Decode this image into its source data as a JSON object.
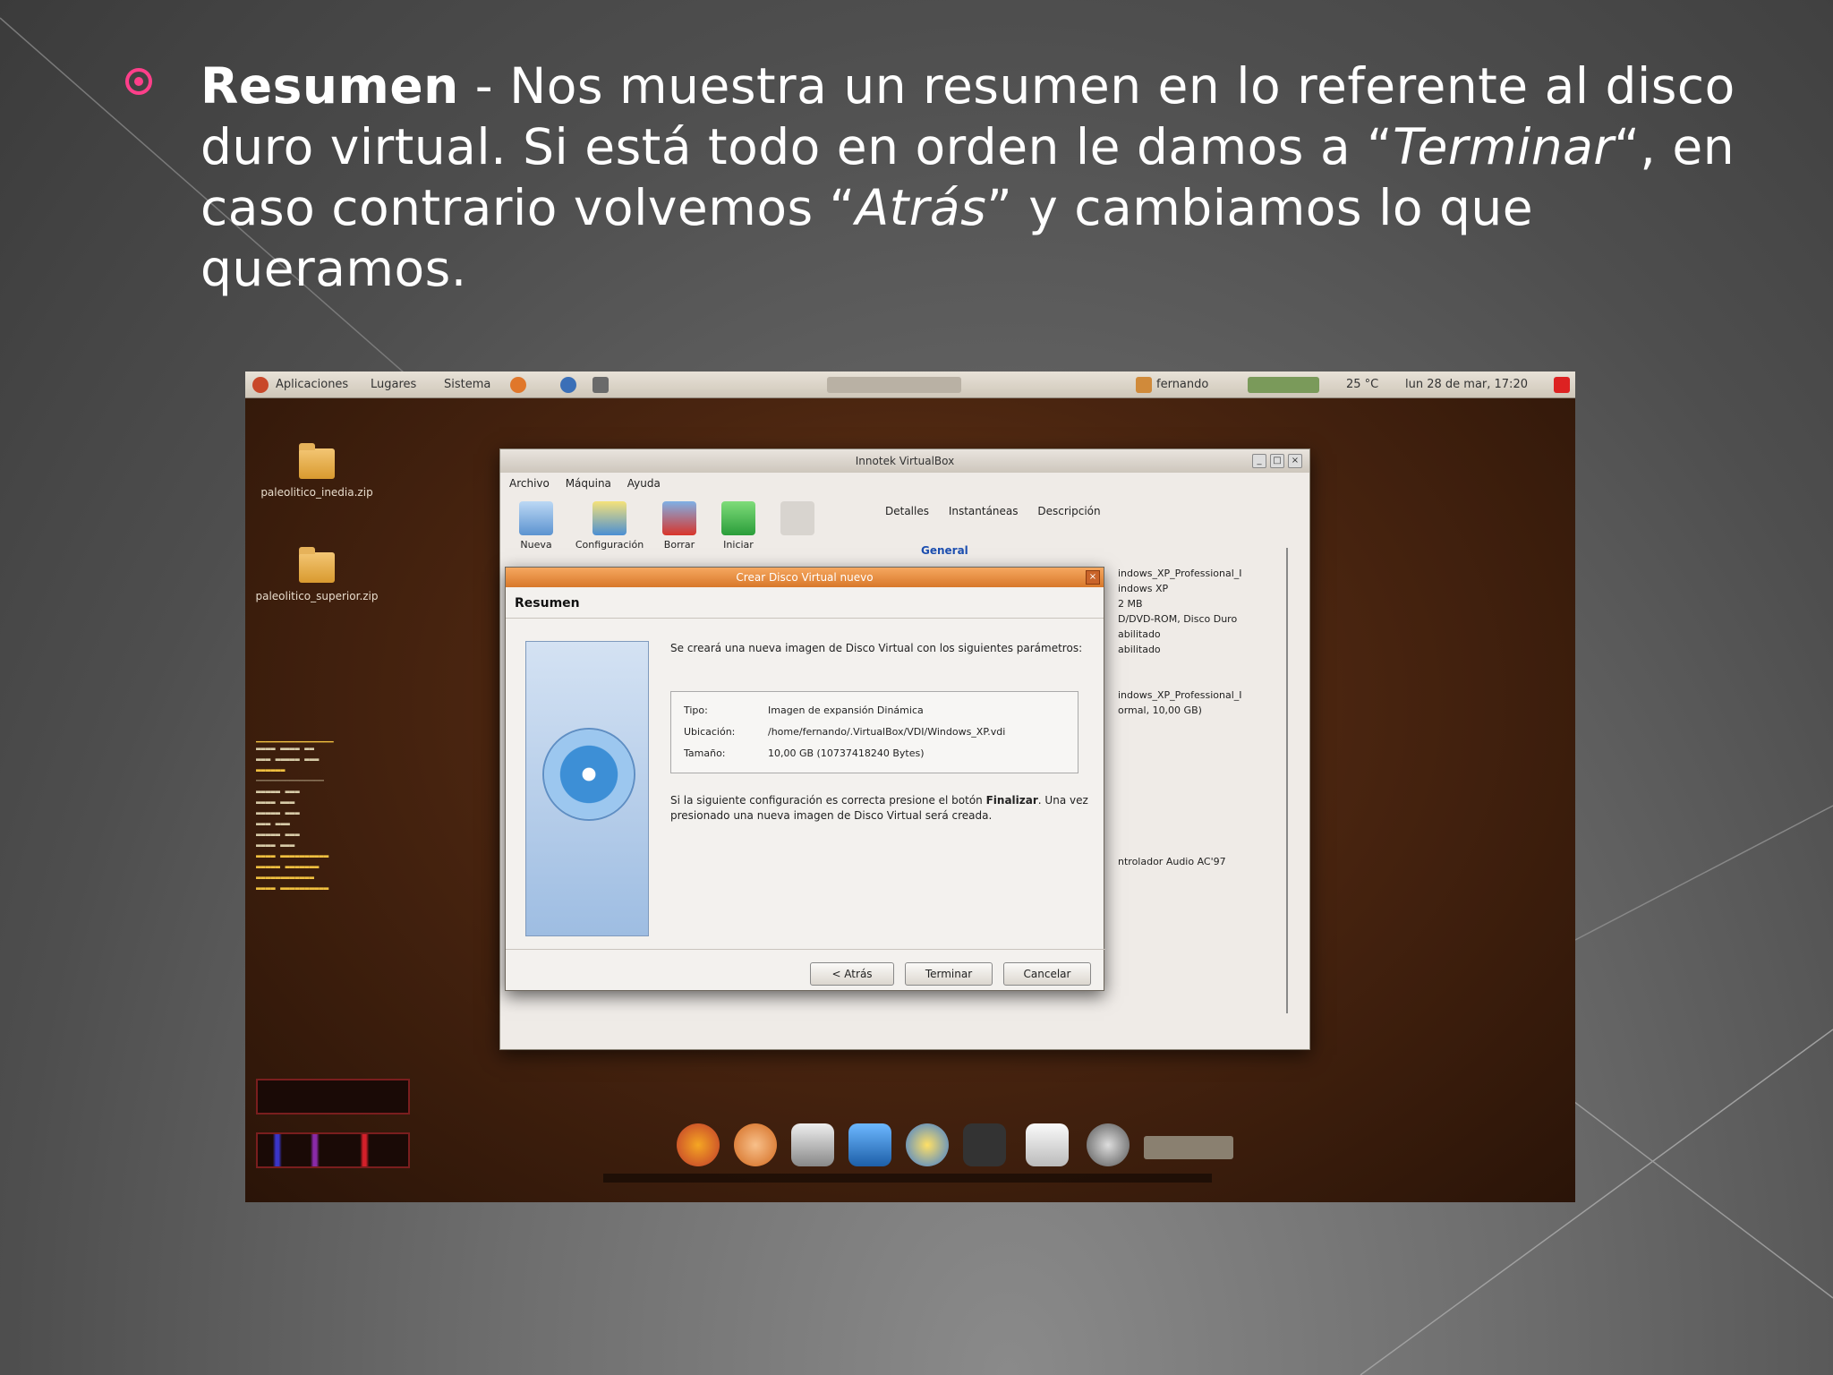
{
  "slide": {
    "term": "Resumen",
    "text_1": " - Nos muestra un resumen en lo referente al disco duro virtual. Si está todo en orden le damos a “",
    "terminar": "Terminar",
    "text_2": "“, en caso contrario volvemos “",
    "atras": "Atrás",
    "text_3": "” y cambiamos lo que queramos."
  },
  "colors": {
    "bullet": "#ff3f8a",
    "slide_text": "#ffffff",
    "wizard_title": "#d8782a"
  },
  "screenshot": {
    "panel": {
      "menus": [
        "Aplicaciones",
        "Lugares",
        "Sistema"
      ],
      "user": "fernando",
      "temp": "25 °C",
      "clock": "lun 28 de mar, 17:20"
    },
    "desktop_icons": [
      {
        "label": "paleolitico_inedia.zip"
      },
      {
        "label": "paleolitico_superior.zip"
      }
    ],
    "vbox": {
      "title": "Innotek VirtualBox",
      "menu": [
        "Archivo",
        "Máquina",
        "Ayuda"
      ],
      "toolbar": [
        "Nueva",
        "Configuración",
        "Borrar",
        "Iniciar"
      ],
      "tabs": [
        "Detalles",
        "Instantáneas",
        "Descripción"
      ],
      "section": "General",
      "details": [
        "indows_XP_Professional_I",
        "indows XP",
        "2 MB",
        "D/DVD-ROM, Disco Duro",
        "abilitado",
        "abilitado",
        "indows_XP_Professional_I",
        "ormal, 10,00 GB)",
        "ntrolador Audio AC'97"
      ]
    },
    "wizard": {
      "title": "Crear Disco Virtual nuevo",
      "heading": "Resumen",
      "intro": "Se creará una nueva imagen de Disco Virtual con los siguientes parámetros:",
      "rows": [
        {
          "label": "Tipo:",
          "value": "Imagen de expansión Dinámica"
        },
        {
          "label": "Ubicación:",
          "value": "/home/fernando/.VirtualBox/VDI/Windows_XP.vdi"
        },
        {
          "label": "Tamaño:",
          "value": "10,00 GB (10737418240 Bytes)"
        }
      ],
      "note_1": "Si la siguiente configuración es correcta presione el botón ",
      "note_bold": "Finalizar",
      "note_2": ". Una vez presionado una nueva imagen de Disco Virtual será creada.",
      "buttons": {
        "back": "< Atrás",
        "finish": "Terminar",
        "cancel": "Cancelar"
      }
    }
  }
}
